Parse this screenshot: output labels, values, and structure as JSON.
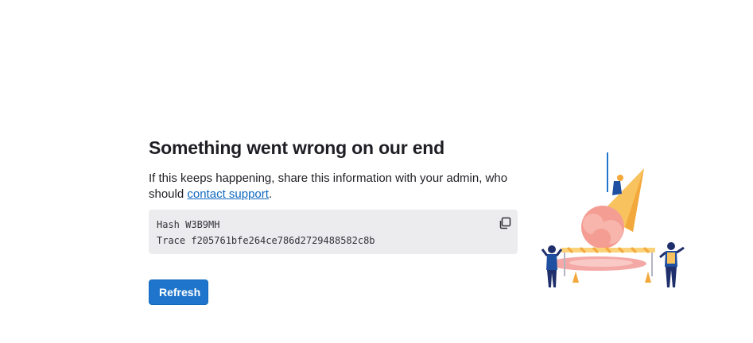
{
  "error": {
    "title": "Something went wrong on our end",
    "message_prefix": "If this keeps happening, share this information with your admin, who should ",
    "support_link_label": "contact support",
    "message_suffix": ".",
    "hash_line": "Hash W3B9MH",
    "trace_line": "Trace f205761bfe264ce786d2729488582c8b",
    "copy_icon": "copy-icon",
    "refresh_label": "Refresh"
  },
  "colors": {
    "primary_button": "#1f75cb",
    "link": "#1068bf",
    "code_background": "#ececef",
    "text": "#1f1e24"
  },
  "illustration": {
    "name": "melted-ice-cream-cone-workers-illustration"
  }
}
